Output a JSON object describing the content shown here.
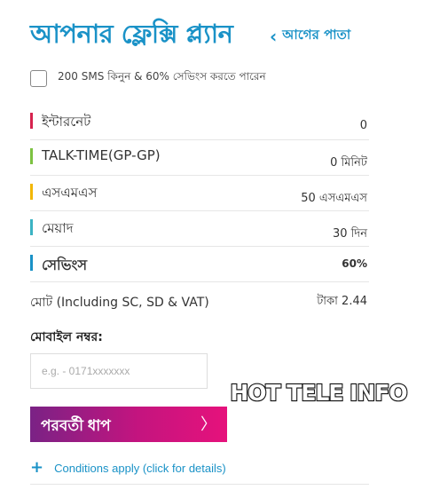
{
  "header": {
    "title": "আপনার ফ্লেক্সি প্ল্যান",
    "back_label": "আগের পাতা"
  },
  "sms_offer": {
    "label": "200 SMS কিনুন & 60% সেভিংস করতে পারেন",
    "checked": false
  },
  "plan_rows": [
    {
      "label": "ইন্টারনেট",
      "value": "0",
      "bar_color": "#d6234e"
    },
    {
      "label": "TALK-TIME(GP-GP)",
      "value": "0 মিনিট",
      "bar_color": "#7dc242"
    },
    {
      "label": "এসএমএস",
      "value": "50 এসএমএস",
      "bar_color": "#f2b705"
    },
    {
      "label": "মেয়াদ",
      "value": "30 দিন",
      "bar_color": "#3bb3c3"
    },
    {
      "label": "সেভিংস",
      "value": "60%",
      "bar_color": "#1a92c7"
    }
  ],
  "total": {
    "label": "মোট (Including SC, SD & VAT)",
    "value": "টাকা 2.44"
  },
  "mobile": {
    "label": "মোবাইল নম্বর:",
    "placeholder": "e.g. - 0171xxxxxxx",
    "value": ""
  },
  "next_button": {
    "label": "পরবর্তী ধাপ",
    "chevron": "〉"
  },
  "conditions": {
    "label": "Conditions apply (click for details)"
  },
  "watermark": {
    "text": "HOT TELE INFO"
  },
  "colors": {
    "accent": "#1a92c7",
    "button_start": "#7a2285",
    "button_end": "#e6127c"
  }
}
